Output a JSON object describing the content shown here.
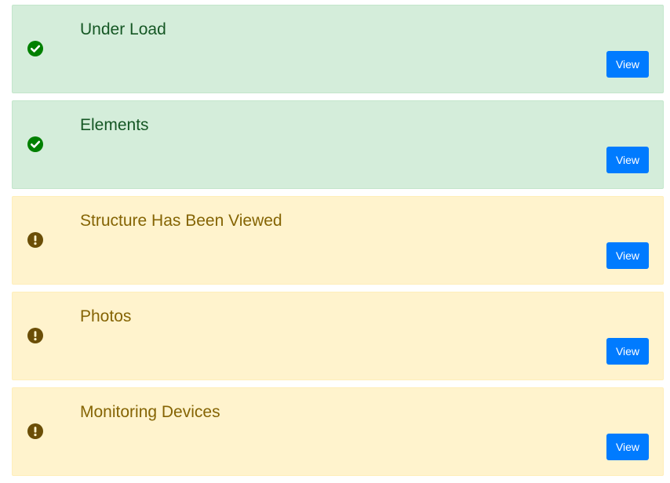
{
  "checklist": {
    "items": [
      {
        "title": "Under Load",
        "status": "complete",
        "status_icon": "check-circle-icon",
        "status_color": "#008000",
        "button_label": "View"
      },
      {
        "title": "Elements",
        "status": "complete",
        "status_icon": "check-circle-icon",
        "status_color": "#008000",
        "button_label": "View"
      },
      {
        "title": "Structure Has Been Viewed",
        "status": "incomplete",
        "status_icon": "exclamation-circle-icon",
        "status_color": "#6b4e07",
        "button_label": "View"
      },
      {
        "title": "Photos",
        "status": "incomplete",
        "status_icon": "exclamation-circle-icon",
        "status_color": "#6b4e07",
        "button_label": "View"
      },
      {
        "title": "Monitoring Devices",
        "status": "incomplete",
        "status_icon": "exclamation-circle-icon",
        "status_color": "#6b4e07",
        "button_label": "View"
      }
    ]
  },
  "colors": {
    "success_background": "#d4edda",
    "success_text": "#155724",
    "warning_background": "#fff3cd",
    "warning_text": "#856404",
    "button_primary": "#007bff"
  }
}
